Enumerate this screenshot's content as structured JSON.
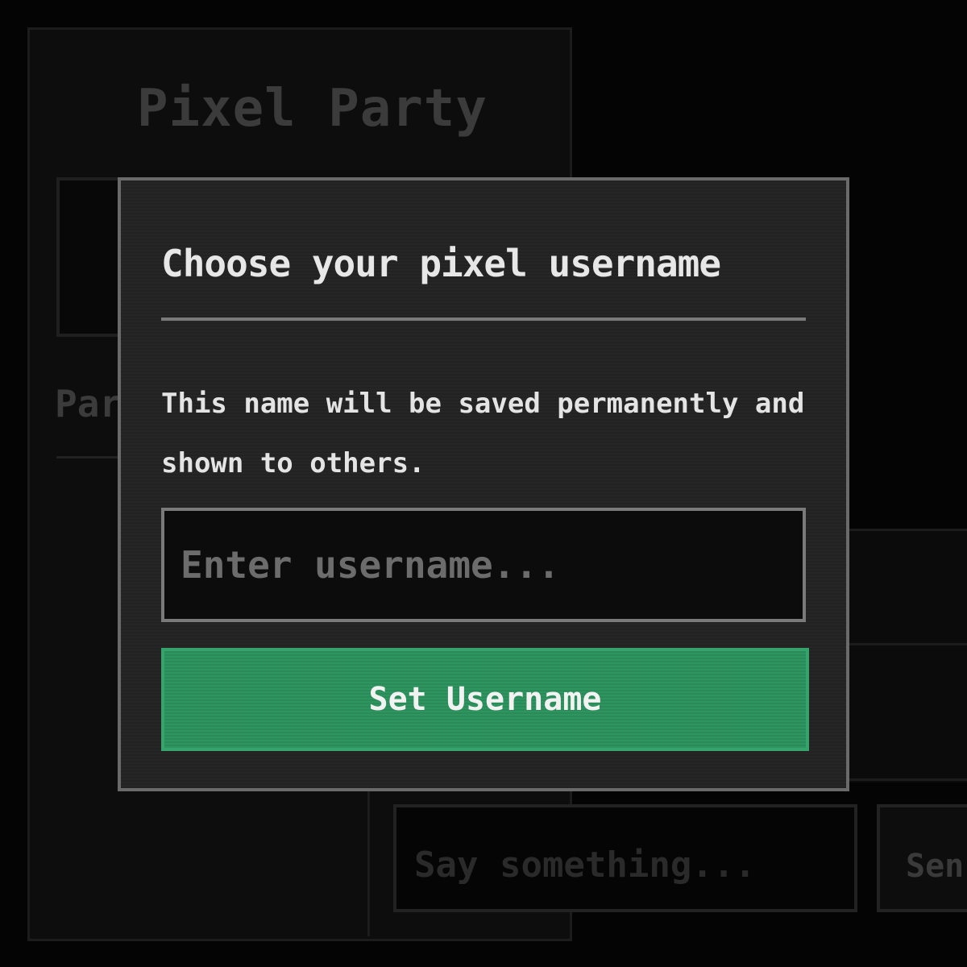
{
  "app": {
    "title": "Pixel Party",
    "section_label": "Par"
  },
  "chat": {
    "input_placeholder": "Say something...",
    "send_label": "Sen"
  },
  "modal": {
    "title": "Choose your pixel username",
    "description": "This name will be saved permanently and shown to others.",
    "input_placeholder": "Enter username...",
    "input_value": "",
    "submit_label": "Set Username"
  },
  "colors": {
    "background": "#040404",
    "modal_background": "#242424",
    "modal_border": "#6a6a6a",
    "accent_green": "#2e9460",
    "text_primary": "#e7e7e7",
    "text_muted": "#6c6c6c"
  }
}
